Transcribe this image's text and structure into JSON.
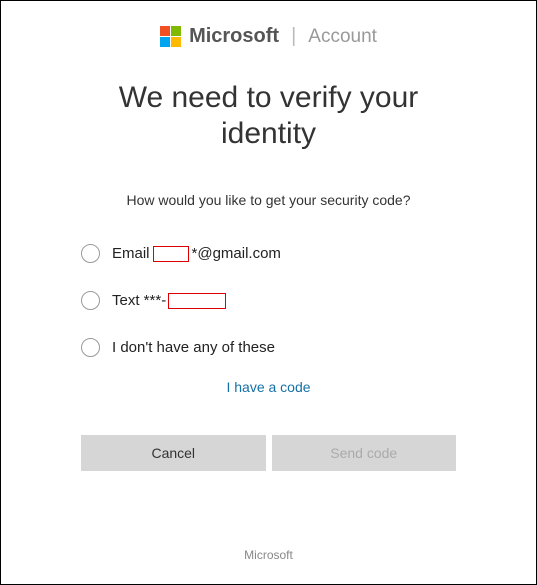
{
  "header": {
    "brand": "Microsoft",
    "account": "Account"
  },
  "title": "We need to verify your identity",
  "prompt": "How would you like to get your security code?",
  "options": {
    "email_prefix": "Email ",
    "email_suffix": "*@gmail.com",
    "text_prefix": "Text ***-",
    "none": "I don't have any of these"
  },
  "have_code": "I have a code",
  "buttons": {
    "cancel": "Cancel",
    "send": "Send code"
  },
  "footer": "Microsoft"
}
